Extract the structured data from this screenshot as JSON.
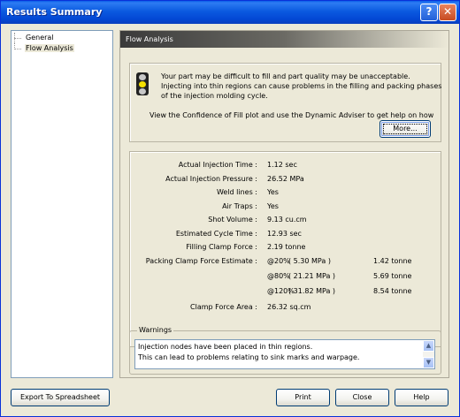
{
  "window": {
    "title": "Results Summary",
    "help_glyph": "?",
    "close_glyph": "✕"
  },
  "tree": {
    "items": [
      {
        "label": "General"
      },
      {
        "label": "Flow Analysis"
      }
    ]
  },
  "panel": {
    "header": "Flow Analysis",
    "message": {
      "line1": "Your part may be difficult to fill and part quality may be unacceptable.",
      "line2": "Injecting into thin regions can cause problems in the filling and packing phases",
      "line3": "of the injection molding cycle.",
      "line4": "View the Confidence of Fill plot and use the Dynamic Adviser to get help on how"
    },
    "more_label": "More...",
    "results": [
      {
        "label": "Actual Injection Time :",
        "value": "1.12 sec"
      },
      {
        "label": "Actual Injection Pressure :",
        "value": "26.52 MPa"
      },
      {
        "label": "Weld lines :",
        "value": "Yes"
      },
      {
        "label": "Air Traps :",
        "value": "Yes"
      },
      {
        "label": "Shot Volume :",
        "value": "9.13 cu.cm"
      },
      {
        "label": "Estimated Cycle Time :",
        "value": "12.93 sec"
      },
      {
        "label": "Filling Clamp Force :",
        "value": "2.19 tonne"
      }
    ],
    "packing": {
      "label": "Packing Clamp Force Estimate :",
      "rows": [
        {
          "pct": "@20%",
          "mpa": "( 5.30 MPa )",
          "tonne": "1.42 tonne"
        },
        {
          "pct": "@80%",
          "mpa": "( 21.21 MPa )",
          "tonne": "5.69 tonne"
        },
        {
          "pct": "@120%",
          "mpa": "( 31.82 MPa )",
          "tonne": "8.54 tonne"
        }
      ]
    },
    "clamp_area": {
      "label": "Clamp Force Area :",
      "value": "26.32 sq.cm"
    },
    "warnings": {
      "title": "Warnings",
      "lines": [
        "Injection nodes have been placed in thin regions.",
        "This can lead to problems relating to sink marks and warpage."
      ]
    }
  },
  "buttons": {
    "export": "Export To Spreadsheet",
    "print": "Print",
    "close": "Close",
    "help": "Help"
  },
  "colors": {
    "title_bar": "#0a5ce8",
    "lamp_red": "#c8c8c8",
    "lamp_yellow": "#f5e000",
    "lamp_green": "#c8c8c8"
  }
}
